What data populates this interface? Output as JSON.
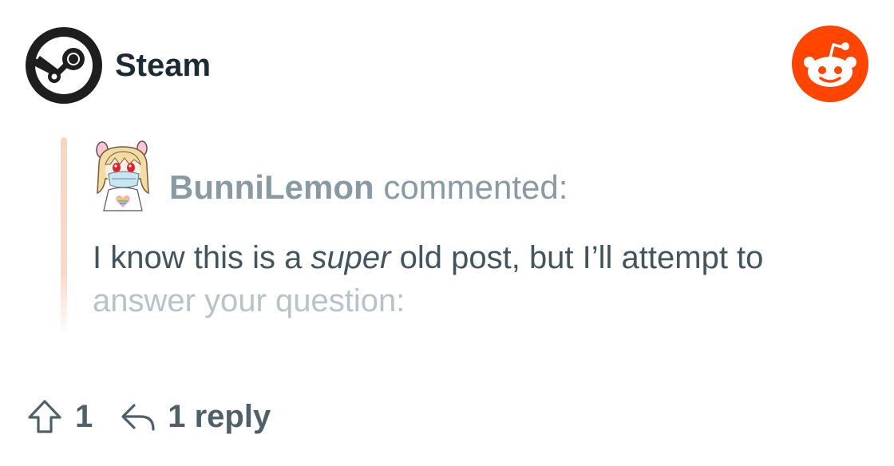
{
  "community": {
    "name": "Steam",
    "icon": "steam-icon"
  },
  "platform": {
    "icon": "reddit-logo-icon",
    "color": "#ff4500"
  },
  "comment": {
    "username": "BunniLemon",
    "action": "commented:",
    "body_before": "I know this is a ",
    "body_emphasis": "super",
    "body_after": " old post, but I’ll attempt to",
    "body_line2": "answer your question:"
  },
  "footer": {
    "upvote_icon": "upvote-arrow-icon",
    "upvote_count": "1",
    "reply_icon": "reply-arrow-icon",
    "reply_label": "1 reply"
  },
  "colors": {
    "quote_bar": "#fbd5c4",
    "title": "#1c2b33",
    "muted": "#8a9aa3",
    "body": "#44545c"
  }
}
